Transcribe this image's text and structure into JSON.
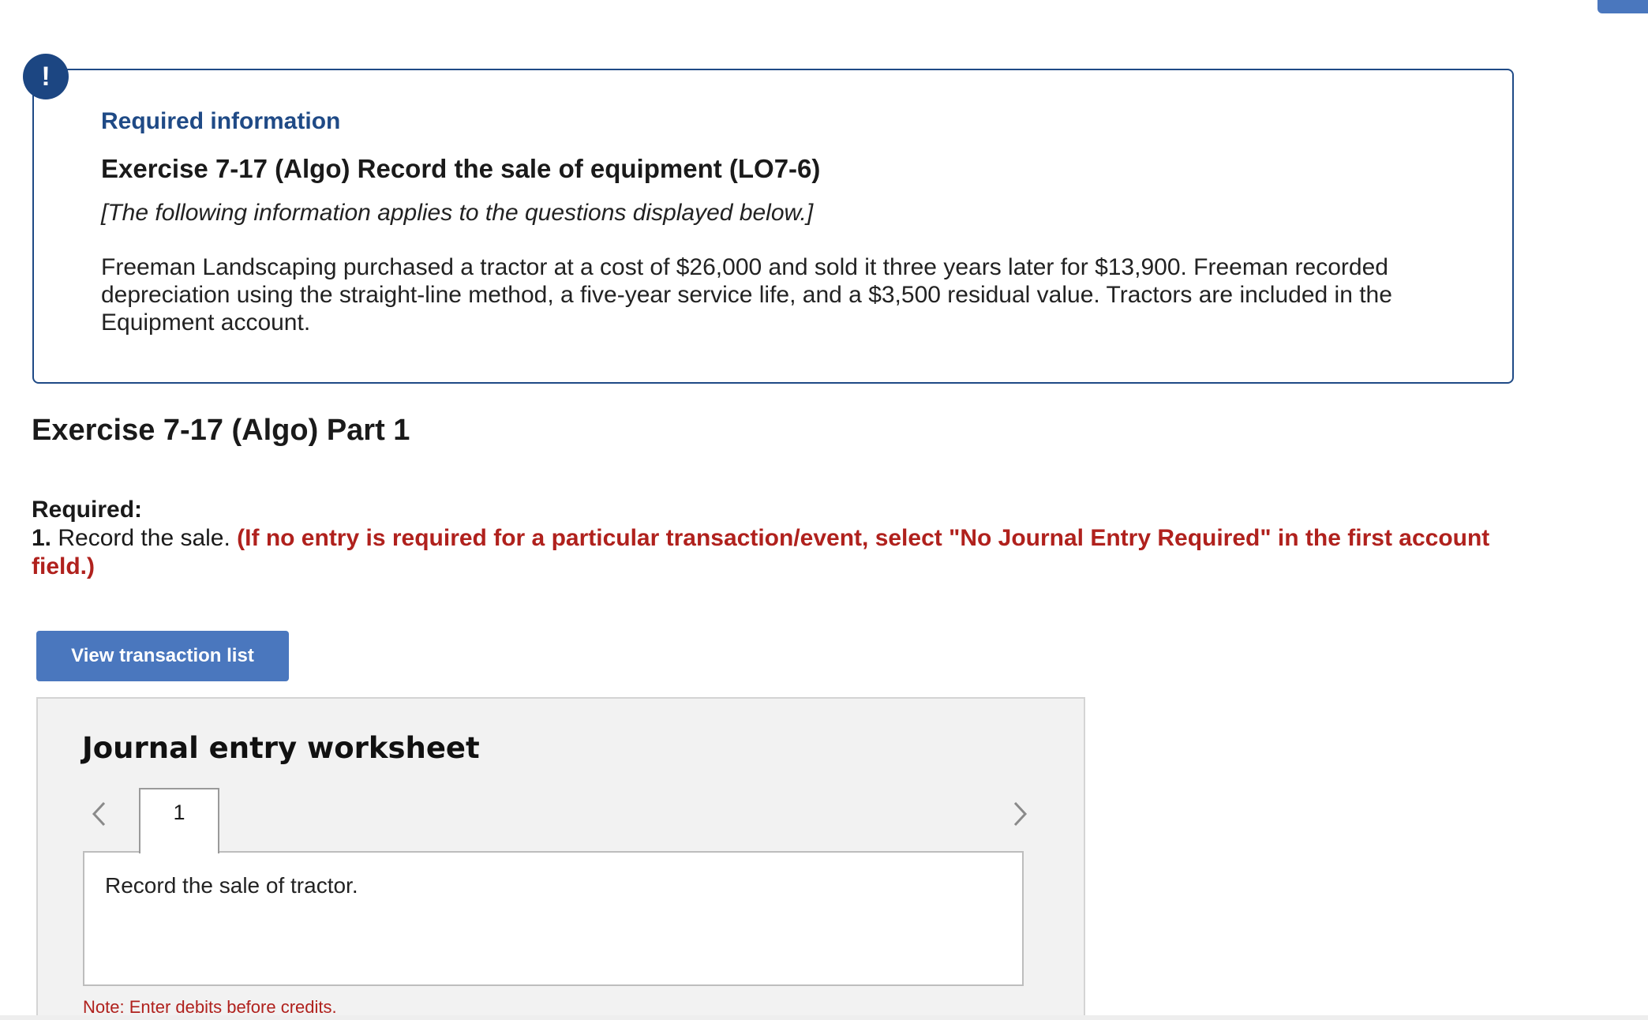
{
  "alert": {
    "icon": "exclamation-icon",
    "symbol": "!"
  },
  "info": {
    "heading": "Required information",
    "exercise_title": "Exercise 7-17 (Algo) Record the sale of equipment (LO7-6)",
    "applies_note": "[The following information applies to the questions displayed below.]",
    "scenario": "Freeman Landscaping purchased a tractor at a cost of $26,000 and sold it three years later for $13,900. Freeman recorded depreciation using the straight-line method, a five-year service life, and a $3,500 residual value. Tractors are included in the Equipment account."
  },
  "part": {
    "title": "Exercise 7-17 (Algo) Part 1"
  },
  "required": {
    "label": "Required:",
    "number": "1.",
    "task": "Record the sale.",
    "instruction": "(If no entry is required for a particular transaction/event, select \"No Journal Entry Required\" in the first account field.)"
  },
  "buttons": {
    "view_transactions": "View transaction list"
  },
  "worksheet": {
    "title": "Journal entry worksheet",
    "tabs": [
      "1"
    ],
    "entry_description": "Record the sale of tractor.",
    "note": "Note: Enter debits before credits."
  },
  "colors": {
    "brand_blue": "#1f4a86",
    "button_blue": "#4a77be",
    "instruction_red": "#b0211d"
  }
}
